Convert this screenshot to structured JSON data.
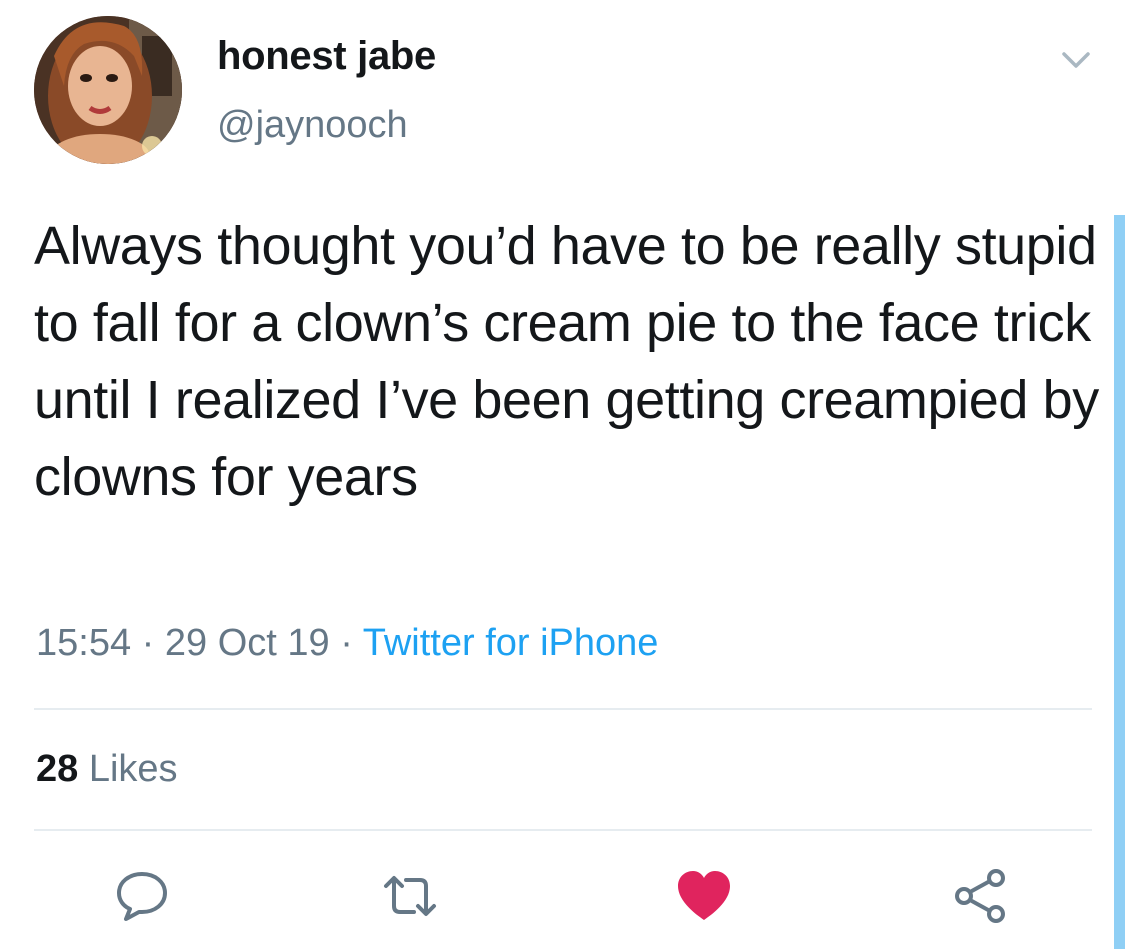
{
  "author": {
    "display_name": "honest jabe",
    "handle": "@jaynooch",
    "avatar_icon": "profile-photo"
  },
  "tweet": {
    "text": "Always thought you’d have to be really stupid to fall for a clown’s cream pie to the face trick until I realized I’ve been getting creampied by clowns for years",
    "time": "15:54",
    "separator": " · ",
    "date": "29 Oct 19",
    "source": "Twitter for iPhone"
  },
  "stats": {
    "likes_count": "28",
    "likes_label": " Likes"
  },
  "actions": {
    "reply_icon": "speech-bubble-icon",
    "retweet_icon": "retweet-arrows-icon",
    "like_icon": "heart-icon",
    "share_icon": "share-nodes-icon"
  },
  "colors": {
    "text_primary": "#14171a",
    "text_secondary": "#657786",
    "link": "#1da1f2",
    "like_active": "#e0245e",
    "divider": "#e6ecf0",
    "scrollbar": "#8fcff5"
  }
}
